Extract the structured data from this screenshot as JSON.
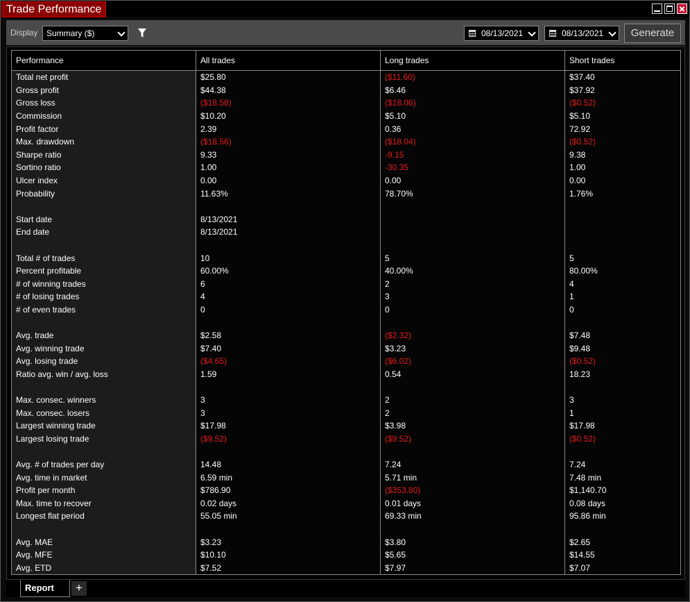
{
  "window": {
    "title": "Trade Performance"
  },
  "toolbar": {
    "display_label": "Display",
    "display_value": "Summary ($)",
    "date_from": "08/13/2021",
    "date_to": "08/13/2021",
    "generate_label": "Generate"
  },
  "colors": {
    "title_tab": "#8b0000",
    "negative": "#e31b1b",
    "toolbar": "#4a4a4a"
  },
  "table": {
    "headers": [
      "Performance",
      "All trades",
      "Long trades",
      "Short trades"
    ],
    "rows": [
      {
        "label": "Total net profit",
        "all": "$25.80",
        "long": "($11.60)",
        "short": "$37.40"
      },
      {
        "label": "Gross profit",
        "all": "$44.38",
        "long": "$6.46",
        "short": "$37.92"
      },
      {
        "label": "Gross loss",
        "all": "($18.58)",
        "long": "($18.06)",
        "short": "($0.52)"
      },
      {
        "label": "Commission",
        "all": "$10.20",
        "long": "$5.10",
        "short": "$5.10"
      },
      {
        "label": "Profit factor",
        "all": "2.39",
        "long": "0.36",
        "short": "72.92"
      },
      {
        "label": "Max. drawdown",
        "all": "($18.56)",
        "long": "($18.04)",
        "short": "($0.52)"
      },
      {
        "label": "Sharpe ratio",
        "all": "9.33",
        "long": "-9.15",
        "short": "9.38"
      },
      {
        "label": "Sortino ratio",
        "all": "1.00",
        "long": "-30.35",
        "short": "1.00"
      },
      {
        "label": "Ulcer index",
        "all": "0.00",
        "long": "0.00",
        "short": "0.00"
      },
      {
        "label": "Probability",
        "all": "11.63%",
        "long": "78.70%",
        "short": "1.76%"
      },
      {
        "label": "",
        "all": "",
        "long": "",
        "short": ""
      },
      {
        "label": "Start date",
        "all": "8/13/2021",
        "long": "",
        "short": ""
      },
      {
        "label": "End date",
        "all": "8/13/2021",
        "long": "",
        "short": ""
      },
      {
        "label": "",
        "all": "",
        "long": "",
        "short": ""
      },
      {
        "label": "Total # of trades",
        "all": "10",
        "long": "5",
        "short": "5"
      },
      {
        "label": "Percent profitable",
        "all": "60.00%",
        "long": "40.00%",
        "short": "80.00%"
      },
      {
        "label": "# of winning trades",
        "all": "6",
        "long": "2",
        "short": "4"
      },
      {
        "label": "# of losing trades",
        "all": "4",
        "long": "3",
        "short": "1"
      },
      {
        "label": "# of even trades",
        "all": "0",
        "long": "0",
        "short": "0"
      },
      {
        "label": "",
        "all": "",
        "long": "",
        "short": ""
      },
      {
        "label": "Avg. trade",
        "all": "$2.58",
        "long": "($2.32)",
        "short": "$7.48"
      },
      {
        "label": "Avg. winning trade",
        "all": "$7.40",
        "long": "$3.23",
        "short": "$9.48"
      },
      {
        "label": "Avg. losing trade",
        "all": "($4.65)",
        "long": "($6.02)",
        "short": "($0.52)"
      },
      {
        "label": "Ratio avg. win / avg. loss",
        "all": "1.59",
        "long": "0.54",
        "short": "18.23"
      },
      {
        "label": "",
        "all": "",
        "long": "",
        "short": ""
      },
      {
        "label": "Max. consec. winners",
        "all": "3",
        "long": "2",
        "short": "3"
      },
      {
        "label": "Max. consec. losers",
        "all": "3",
        "long": "2",
        "short": "1"
      },
      {
        "label": "Largest winning trade",
        "all": "$17.98",
        "long": "$3.98",
        "short": "$17.98"
      },
      {
        "label": "Largest losing trade",
        "all": "($9.52)",
        "long": "($9.52)",
        "short": "($0.52)"
      },
      {
        "label": "",
        "all": "",
        "long": "",
        "short": ""
      },
      {
        "label": "Avg. # of trades per day",
        "all": "14.48",
        "long": "7.24",
        "short": "7.24"
      },
      {
        "label": "Avg. time in market",
        "all": "6.59 min",
        "long": "5.71 min",
        "short": "7.48 min"
      },
      {
        "label": "Profit per month",
        "all": "$786.90",
        "long": "($353.80)",
        "short": "$1,140.70"
      },
      {
        "label": "Max. time to recover",
        "all": "0.02 days",
        "long": "0.01 days",
        "short": "0.08 days"
      },
      {
        "label": "Longest flat period",
        "all": "55.05 min",
        "long": "69.33 min",
        "short": "95.86 min"
      },
      {
        "label": "",
        "all": "",
        "long": "",
        "short": ""
      },
      {
        "label": "Avg. MAE",
        "all": "$3.23",
        "long": "$3.80",
        "short": "$2.65"
      },
      {
        "label": "Avg. MFE",
        "all": "$10.10",
        "long": "$5.65",
        "short": "$14.55"
      },
      {
        "label": "Avg. ETD",
        "all": "$7.52",
        "long": "$7.97",
        "short": "$7.07"
      }
    ]
  },
  "tabs": {
    "report_label": "Report",
    "add_label": "+"
  }
}
